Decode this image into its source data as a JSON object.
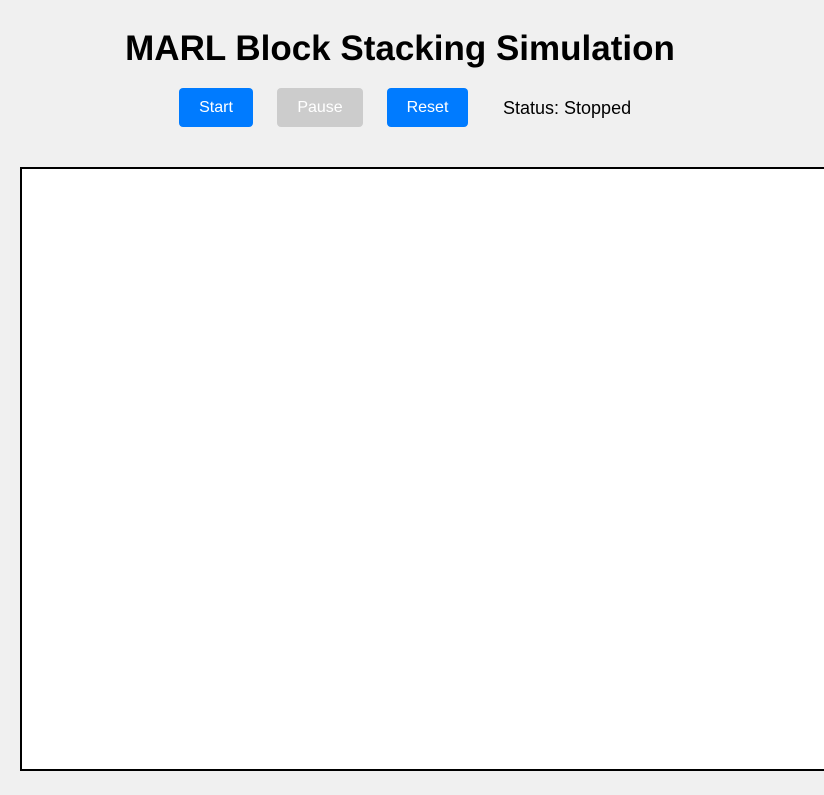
{
  "page": {
    "title": "MARL Block Stacking Simulation"
  },
  "controls": {
    "start": {
      "label": "Start",
      "enabled": true,
      "color": "#007bff"
    },
    "pause": {
      "label": "Pause",
      "enabled": false,
      "color": "#cccccc"
    },
    "reset": {
      "label": "Reset",
      "enabled": true,
      "color": "#007bff"
    }
  },
  "status": {
    "text": "Status: Stopped"
  },
  "canvas": {
    "background": "#ffffff",
    "border_color": "#000000"
  }
}
